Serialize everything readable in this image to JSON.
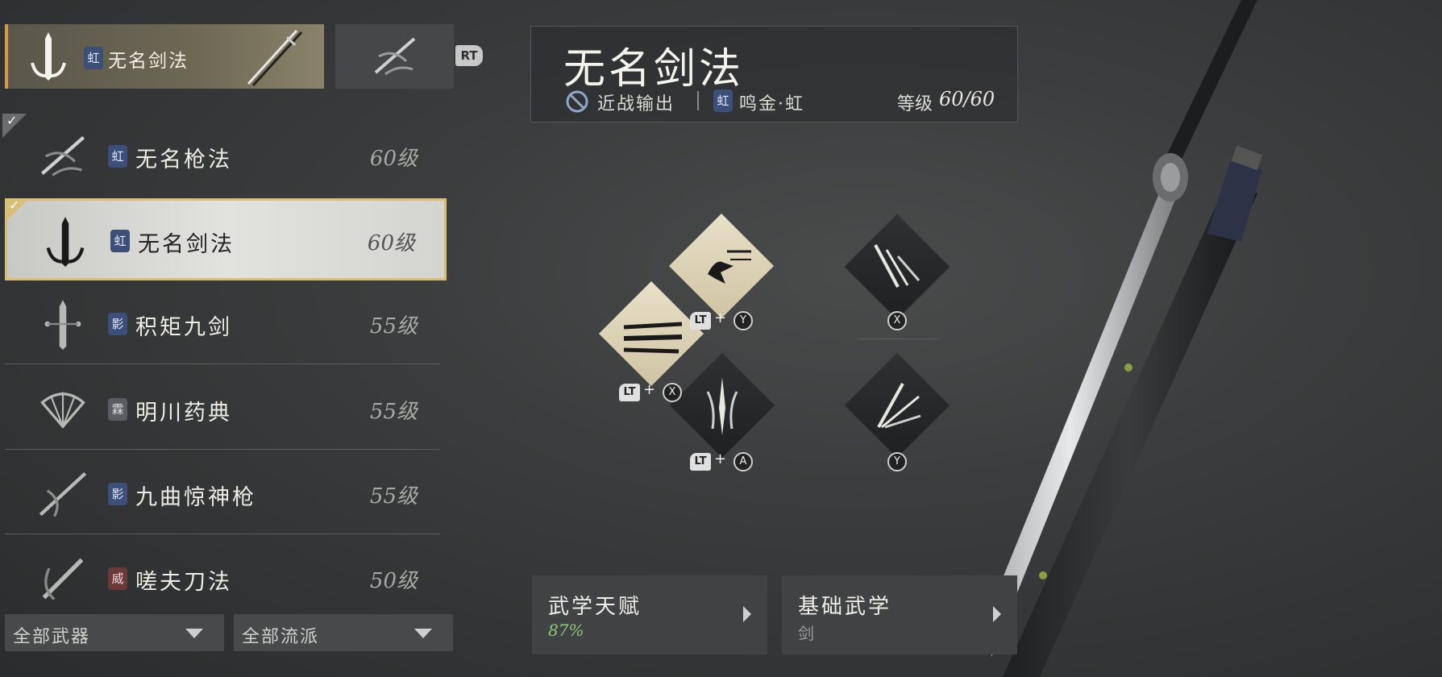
{
  "equipped": {
    "primary_name": "无名剑法",
    "primary_badge": "虹",
    "switch_button": "RT"
  },
  "weapon_list": [
    {
      "name": "无名枪法",
      "badge": "虹",
      "badge_type": "blue",
      "level": "60级",
      "checked": true,
      "selected": false,
      "icon": "spear-art-icon"
    },
    {
      "name": "无名剑法",
      "badge": "虹",
      "badge_type": "blue",
      "level": "60级",
      "checked": true,
      "selected": true,
      "icon": "sword-art-icon"
    },
    {
      "name": "积矩九剑",
      "badge": "影",
      "badge_type": "blue",
      "level": "55级",
      "checked": false,
      "selected": false,
      "icon": "nine-sword-icon"
    },
    {
      "name": "明川药典",
      "badge": "霖",
      "badge_type": "grey",
      "level": "55级",
      "checked": false,
      "selected": false,
      "icon": "fan-icon"
    },
    {
      "name": "九曲惊神枪",
      "badge": "影",
      "badge_type": "blue",
      "level": "55级",
      "checked": false,
      "selected": false,
      "icon": "spear-icon"
    },
    {
      "name": "嗟夫刀法",
      "badge": "威",
      "badge_type": "red",
      "level": "50级",
      "checked": false,
      "selected": false,
      "icon": "blade-icon"
    }
  ],
  "filters": {
    "weapon": "全部武器",
    "school": "全部流派"
  },
  "detail": {
    "title": "无名剑法",
    "role": "近战输出",
    "path_badge": "虹",
    "path": "鸣金·虹",
    "level_label": "等级",
    "level_value": "60/60"
  },
  "skills": {
    "combo1": {
      "lt": "LT",
      "plus": "+",
      "key": "Y"
    },
    "combo2": {
      "lt": "LT",
      "plus": "+",
      "key": "X"
    },
    "combo3": {
      "lt": "LT",
      "plus": "+",
      "key": "A"
    },
    "basic_x": "X",
    "basic_y": "Y"
  },
  "panels": {
    "talent_title": "武学天赋",
    "talent_value": "87%",
    "basic_title": "基础武学",
    "basic_value": "剑"
  },
  "colors": {
    "accent_orange": "#d59a48",
    "selected_border": "#d8bf78",
    "talent_green": "#8ec87a"
  }
}
